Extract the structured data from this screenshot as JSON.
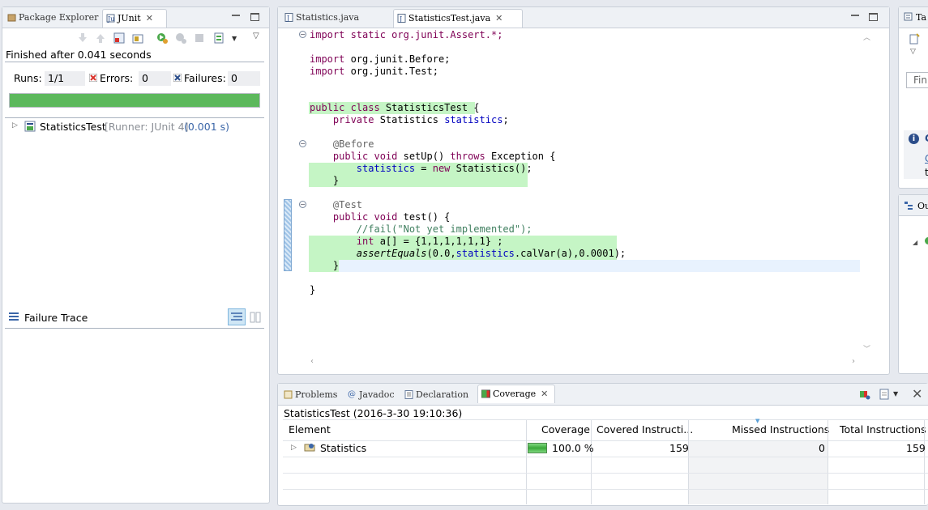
{
  "left_panel": {
    "tabs": [
      {
        "label": "Package Explorer"
      },
      {
        "label": "JUnit"
      }
    ],
    "status": "Finished after 0.041 seconds",
    "runs_label": "Runs:",
    "runs_value": "1/1",
    "errors_label": "Errors:",
    "errors_value": "0",
    "failures_label": "Failures:",
    "failures_value": "0",
    "progress_fraction": 1.0,
    "progress_color": "#5cb85c",
    "tree_item": {
      "name": "StatisticsTest",
      "runner": "[Runner: JUnit 4]",
      "time": "(0.001 s)"
    },
    "failure_trace_label": "Failure Trace"
  },
  "editor": {
    "tabs": [
      {
        "label": "Statistics.java"
      },
      {
        "label": "StatisticsTest.java"
      }
    ],
    "lines": {
      "l1": "import static org.junit.Assert.*;",
      "l2a": "import ",
      "l2b": "org.junit.Before;",
      "l3a": "import ",
      "l3b": "org.junit.Test;",
      "l4kw": "public class ",
      "l4b": "StatisticsTest {",
      "l5kw": "    private ",
      "l5b": "Statistics ",
      "l5f": "statistics",
      "l5c": ";",
      "l6": "    @Before",
      "l7kw": "    public void ",
      "l7b": "setUp() ",
      "l7kw2": "throws ",
      "l7c": "Exception {",
      "l8f": "        statistics",
      "l8b": " = ",
      "l8kw": "new ",
      "l8c": "Statistics();",
      "l9": "    }",
      "l10": "    @Test",
      "l11kw": "    public void ",
      "l11b": "test() {",
      "l12": "        //fail(\"Not yet implemented\");",
      "l13kw": "        int ",
      "l13b": "a[] = {1,1,1,1,1,1} ;",
      "l14s": "        assertEquals",
      "l14b": "(0.0,",
      "l14f": "statistics",
      "l14c": ".calVar(a),0.0001);",
      "l15": "    }",
      "l16": "}"
    },
    "coverage_color": "#c5f5c5"
  },
  "bottom_panel": {
    "tabs": [
      {
        "label": "Problems"
      },
      {
        "label": "Javadoc"
      },
      {
        "label": "Declaration"
      },
      {
        "label": "Coverage"
      }
    ],
    "session": "StatisticsTest (2016-3-30 19:10:36)",
    "columns": [
      "Element",
      "Coverage",
      "Covered Instructi...",
      "Missed Instructions",
      "Total Instructions"
    ],
    "rows": [
      {
        "element": "Statistics",
        "coverage": "100.0 %",
        "coverage_fraction": 1.0,
        "covered": "159",
        "missed": "0",
        "total": "159"
      }
    ]
  },
  "right_panel": {
    "tab_label": "Ta",
    "find_placeholder": "Fin",
    "info_letter": "C",
    "info_link": "C",
    "info_text": "t",
    "outline_label": "Ou"
  }
}
